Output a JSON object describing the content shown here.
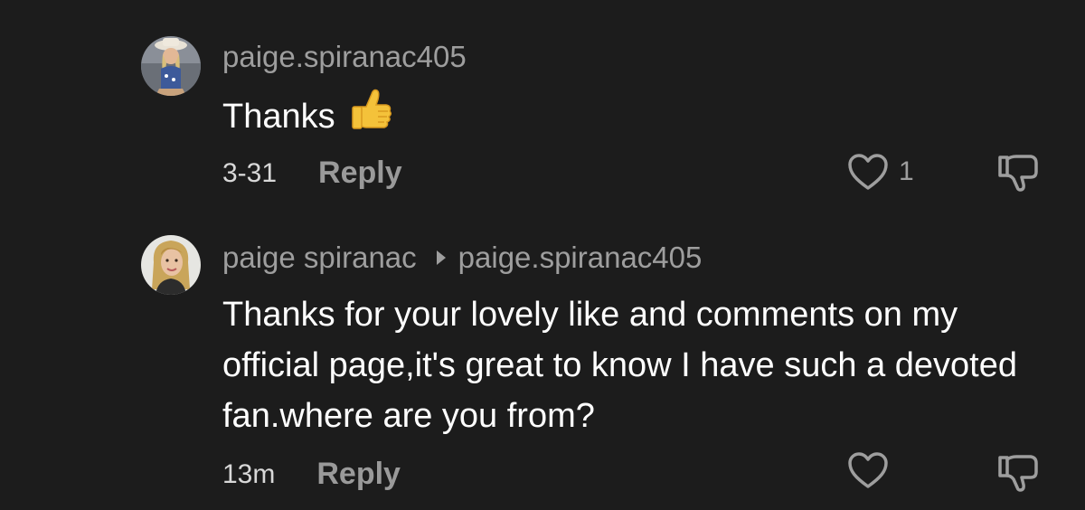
{
  "comments": [
    {
      "username": "paige.spiranac405",
      "text": "Thanks",
      "emoji_icon": "thumbs-up-emoji",
      "time": "3-31",
      "reply_label": "Reply",
      "likes": "1"
    },
    {
      "username": "paige spiranac",
      "reply_to": "paige.spiranac405",
      "text": "Thanks for your lovely like and comments on my official page,it's great to know I have such a devoted fan.where are you from?",
      "time": "13m",
      "reply_label": "Reply",
      "likes": ""
    }
  ],
  "colors": {
    "background": "#1c1c1c",
    "username": "#9e9e9e",
    "text": "#ffffff",
    "reply": "#9a9a9a",
    "emoji": "#f4c23a"
  }
}
